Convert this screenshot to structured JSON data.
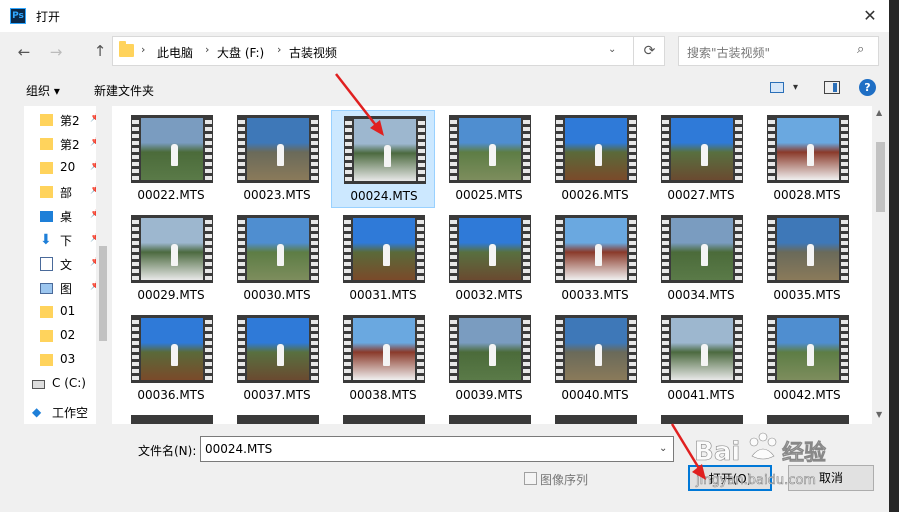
{
  "window": {
    "title": "打开",
    "app_icon": "Ps",
    "close": "✕"
  },
  "nav": {
    "back": "←",
    "forward": "→",
    "up": "↑",
    "breadcrumbs": [
      "此电脑",
      "大盘 (F:)",
      "古装视频"
    ],
    "search_placeholder": "搜索\"古装视频\""
  },
  "toolbar": {
    "organize": "组织 ▾",
    "new_folder": "新建文件夹",
    "help": "?"
  },
  "sidebar": {
    "items": [
      {
        "label": "第2",
        "icon": "folder-icon"
      },
      {
        "label": "第2",
        "icon": "folder-icon"
      },
      {
        "label": "20",
        "icon": "folder-icon"
      },
      {
        "label": "部",
        "icon": "folder-icon"
      },
      {
        "label": "桌",
        "icon": "desktop-icon"
      },
      {
        "label": "下",
        "icon": "download-icon"
      },
      {
        "label": "文",
        "icon": "document-icon"
      },
      {
        "label": "图",
        "icon": "picture-icon"
      },
      {
        "label": "01",
        "icon": "folder-icon"
      },
      {
        "label": "02",
        "icon": "folder-icon"
      },
      {
        "label": "03",
        "icon": "folder-icon"
      },
      {
        "label": "C (C:)",
        "icon": "drive-icon"
      },
      {
        "label": "工作空",
        "icon": "workspace-icon"
      }
    ]
  },
  "files": [
    "00022.MTS",
    "00023.MTS",
    "00024.MTS",
    "00025.MTS",
    "00026.MTS",
    "00027.MTS",
    "00028.MTS",
    "00029.MTS",
    "00030.MTS",
    "00031.MTS",
    "00032.MTS",
    "00033.MTS",
    "00034.MTS",
    "00035.MTS",
    "00036.MTS",
    "00037.MTS",
    "00038.MTS",
    "00039.MTS",
    "00040.MTS",
    "00041.MTS",
    "00042.MTS"
  ],
  "selected_file": "00024.MTS",
  "bottom": {
    "filename_label": "文件名(N):",
    "filename_value": "00024.MTS",
    "image_sequence": "图像序列",
    "open": "打开(O)",
    "cancel": "取消"
  },
  "watermark": {
    "brand": "Baidu经验",
    "url": "jingyan.baidu.com"
  },
  "colors": {
    "accent": "#0078d7",
    "selection": "#cce8ff",
    "arrow": "#e02020"
  }
}
